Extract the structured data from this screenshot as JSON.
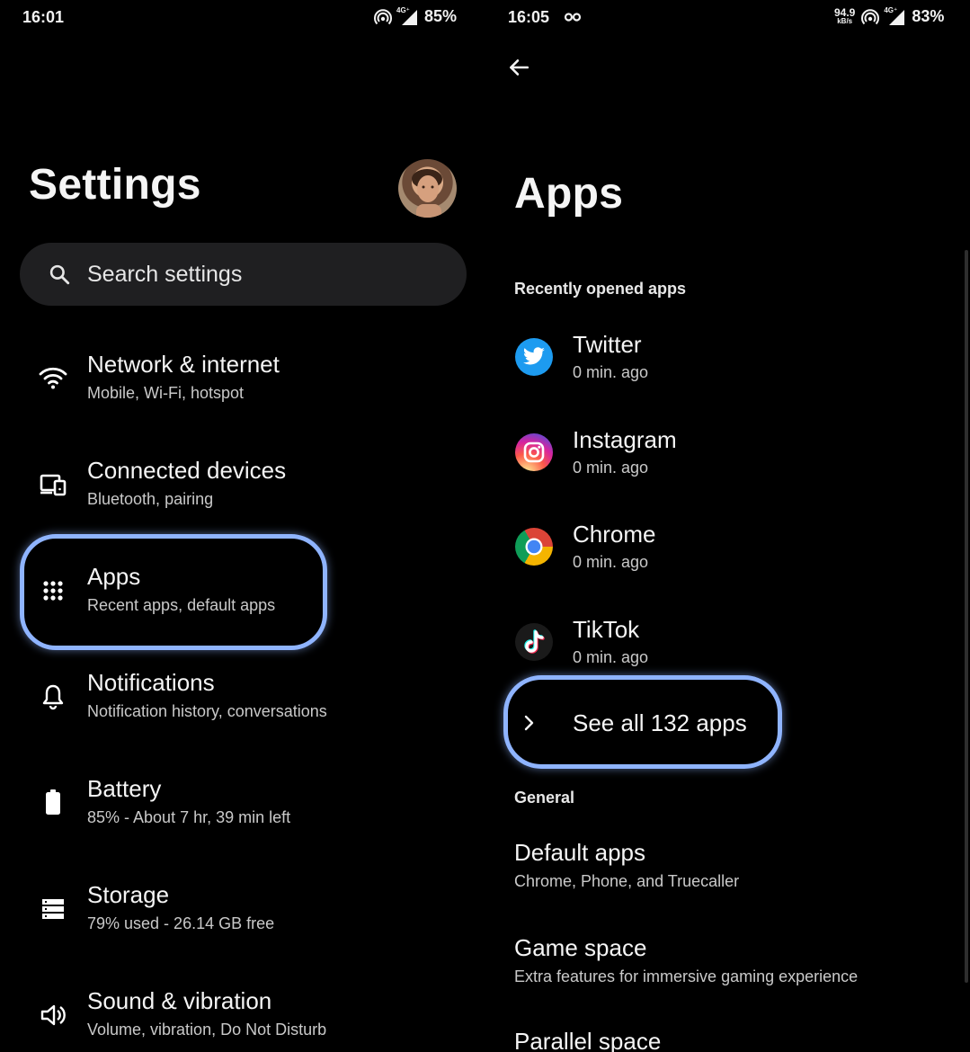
{
  "left": {
    "status": {
      "time": "16:01",
      "network": "4G⁺",
      "battery": "85%"
    },
    "title": "Settings",
    "avatar_icon": "profile-photo",
    "search": {
      "placeholder": "Search settings"
    },
    "items": [
      {
        "title": "Network & internet",
        "subtitle": "Mobile, Wi-Fi, hotspot",
        "icon": "wifi-icon"
      },
      {
        "title": "Connected devices",
        "subtitle": "Bluetooth, pairing",
        "icon": "devices-icon"
      },
      {
        "title": "Apps",
        "subtitle": "Recent apps, default apps",
        "icon": "apps-grid-icon"
      },
      {
        "title": "Notifications",
        "subtitle": "Notification history, conversations",
        "icon": "bell-icon"
      },
      {
        "title": "Battery",
        "subtitle": "85% - About 7 hr, 39 min left",
        "icon": "battery-icon"
      },
      {
        "title": "Storage",
        "subtitle": "79% used - 26.14 GB free",
        "icon": "storage-icon"
      },
      {
        "title": "Sound & vibration",
        "subtitle": "Volume, vibration, Do Not Disturb",
        "icon": "speaker-icon"
      }
    ]
  },
  "right": {
    "status": {
      "time": "16:05",
      "speed_value": "94.9",
      "speed_unit": "kB/s",
      "network": "4G⁺",
      "battery": "83%"
    },
    "title": "Apps",
    "recent_label": "Recently opened apps",
    "recent_apps": [
      {
        "name": "Twitter",
        "time": "0 min. ago",
        "icon": "twitter-icon"
      },
      {
        "name": "Instagram",
        "time": "0 min. ago",
        "icon": "instagram-icon"
      },
      {
        "name": "Chrome",
        "time": "0 min. ago",
        "icon": "chrome-icon"
      },
      {
        "name": "TikTok",
        "time": "0 min. ago",
        "icon": "tiktok-icon"
      }
    ],
    "see_all": "See all 132 apps",
    "general_label": "General",
    "general_items": [
      {
        "title": "Default apps",
        "subtitle": "Chrome, Phone, and Truecaller"
      },
      {
        "title": "Game space",
        "subtitle": "Extra features for immersive gaming experience"
      },
      {
        "title": "Parallel space",
        "subtitle": ""
      }
    ]
  },
  "colors": {
    "background": "#000000",
    "search_bg": "#1f1f21",
    "highlight": "#8fb4ff",
    "twitter": "#1d9bf0",
    "subtitle": "#c9c9c9"
  }
}
